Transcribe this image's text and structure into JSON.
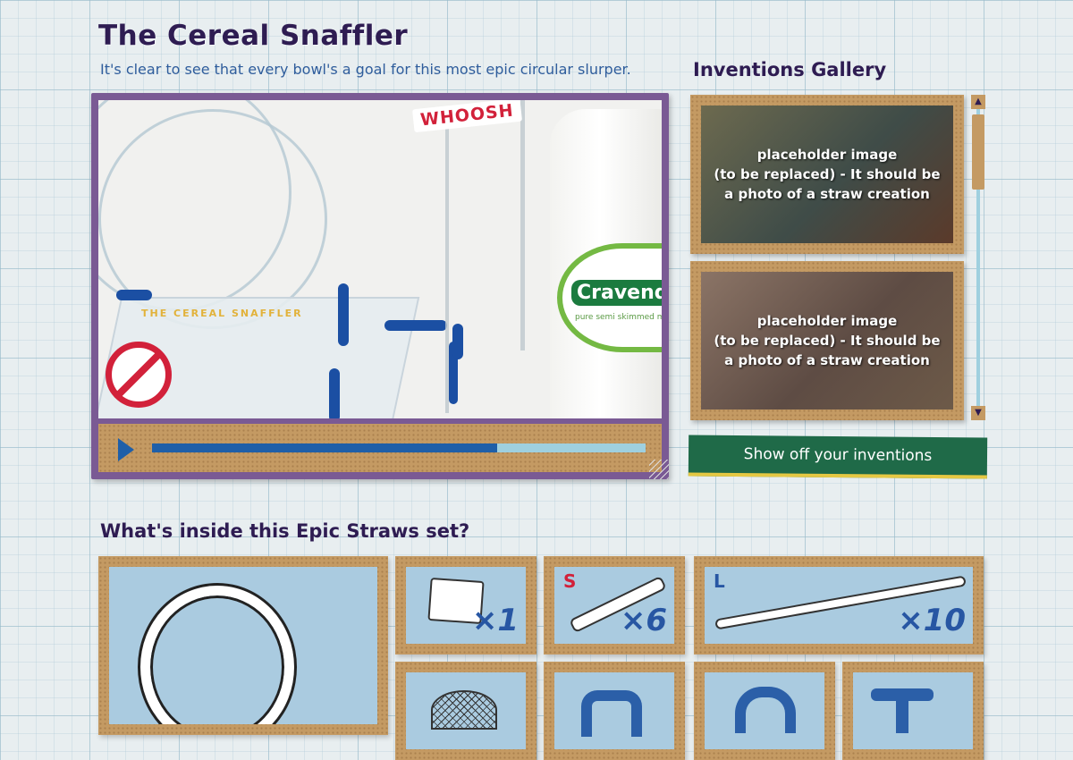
{
  "header": {
    "title": "The Cereal Snaffler",
    "subtitle": "It's clear to see that every bowl's a goal for this most epic circular slurper."
  },
  "video": {
    "sticker_text": "WHOOSH",
    "bottle_brand": "Cravendale",
    "bottle_sub": "pure semi skimmed milk",
    "board_text": "THE CEREAL SNAFFLER",
    "progress": 0.7
  },
  "gallery": {
    "title": "Inventions Gallery",
    "items": [
      {
        "caption": "placeholder image\n(to be replaced) - It should be\na photo of a straw creation"
      },
      {
        "caption": "placeholder image\n(to be replaced) - It should be\na photo of a straw creation"
      }
    ],
    "cta_label": "Show off your inventions"
  },
  "contents": {
    "title": "What's inside this Epic Straws set?",
    "tiles": [
      {
        "name": "connector-plate",
        "qty": "×1"
      },
      {
        "name": "short-straw",
        "size": "S",
        "qty": "×6"
      },
      {
        "name": "long-straw",
        "size": "L",
        "qty": "×10"
      }
    ]
  },
  "colors": {
    "title": "#2e1c52",
    "subtitle": "#2f5d9c",
    "cork": "#c49a63",
    "frame": "#7a5a94",
    "cta_green": "#1f6a48",
    "accent_red": "#d2213a",
    "accent_blue": "#1f5fa8"
  }
}
